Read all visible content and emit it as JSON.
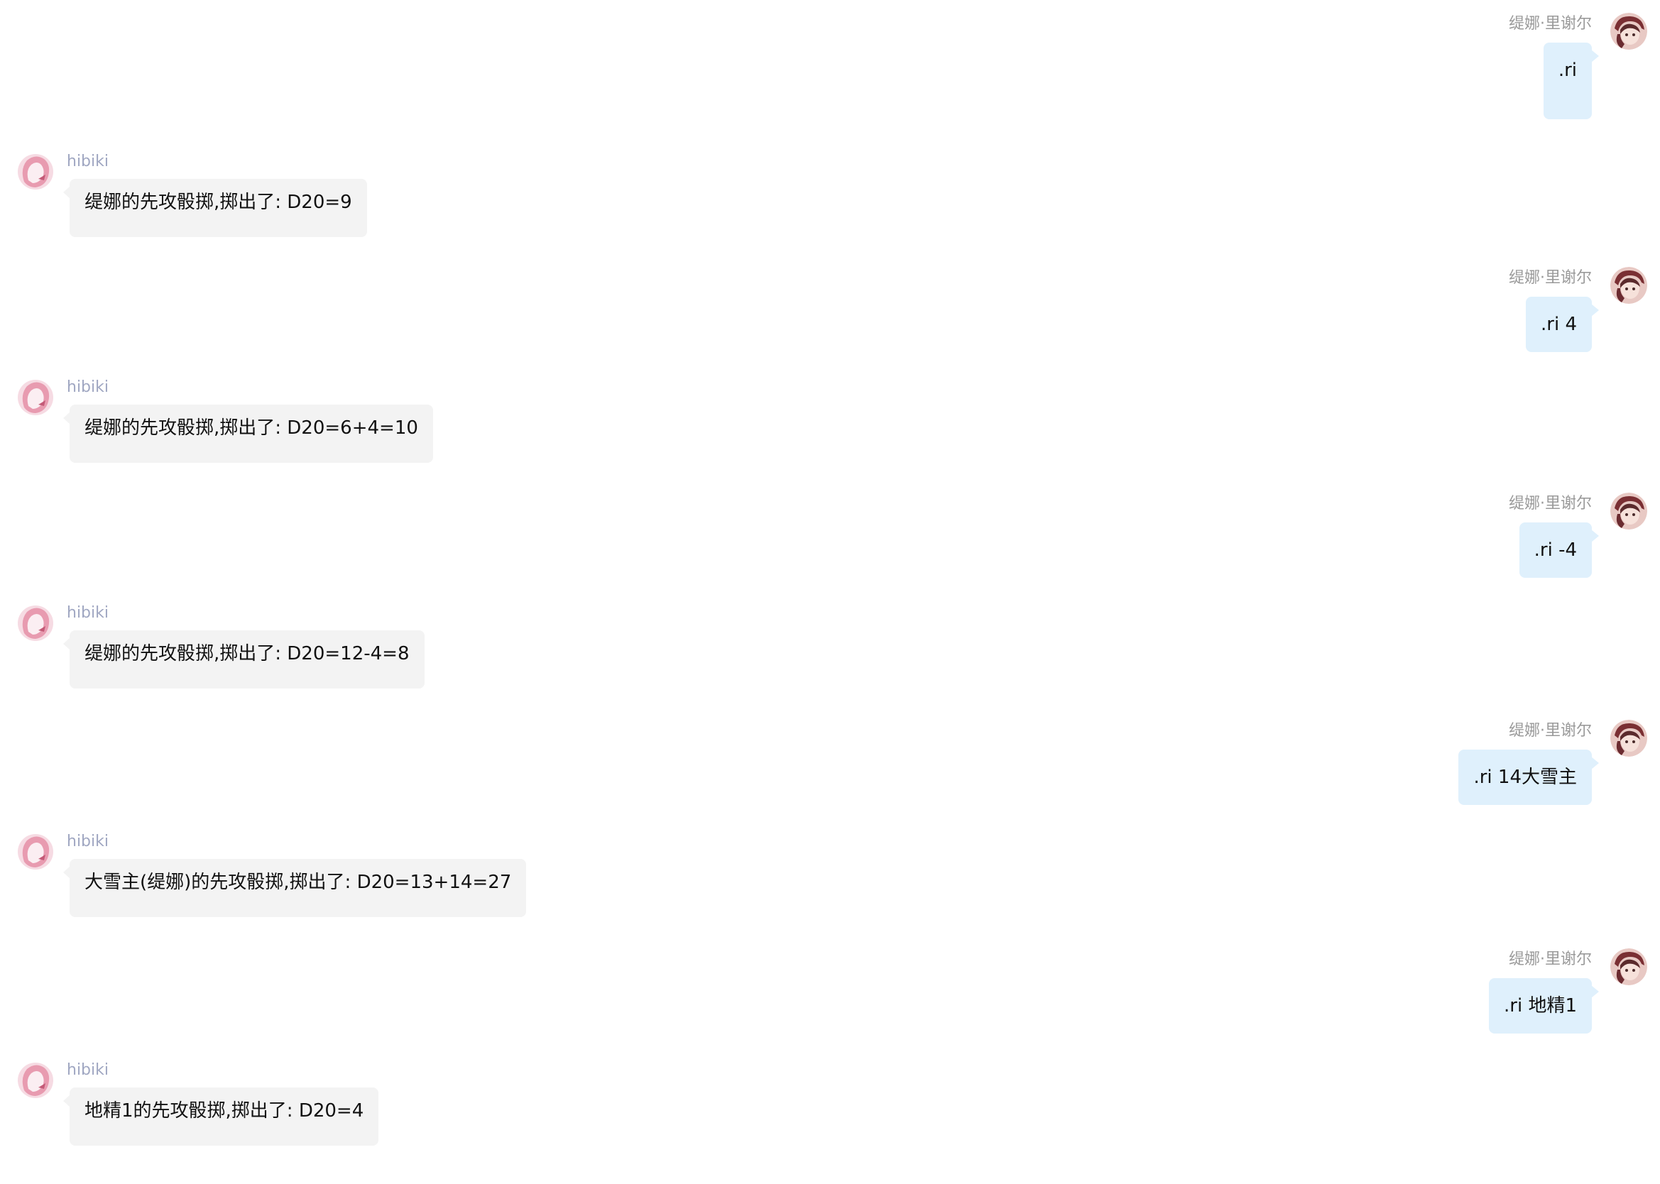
{
  "chat": {
    "messages": [
      {
        "side": "right",
        "sender": "缇娜·里谢尔",
        "text": ".ri"
      },
      {
        "side": "left",
        "sender": "hibiki",
        "text": "缇娜的先攻骰掷,掷出了: D20=9"
      },
      {
        "side": "right",
        "sender": "缇娜·里谢尔",
        "text": ".ri 4"
      },
      {
        "side": "left",
        "sender": "hibiki",
        "text": "缇娜的先攻骰掷,掷出了: D20=6+4=10"
      },
      {
        "side": "right",
        "sender": "缇娜·里谢尔",
        "text": ".ri -4"
      },
      {
        "side": "left",
        "sender": "hibiki",
        "text": "缇娜的先攻骰掷,掷出了: D20=12-4=8"
      },
      {
        "side": "right",
        "sender": "缇娜·里谢尔",
        "text": ".ri 14大雪主"
      },
      {
        "side": "left",
        "sender": "hibiki",
        "text": "大雪主(缇娜)的先攻骰掷,掷出了: D20=13+14=27"
      },
      {
        "side": "right",
        "sender": "缇娜·里谢尔",
        "text": ".ri 地精1"
      },
      {
        "side": "left",
        "sender": "hibiki",
        "text": "地精1的先攻骰掷,掷出了: D20=4"
      }
    ]
  },
  "colors": {
    "user_bubble": "#dff0fc",
    "bot_bubble": "#f3f3f3",
    "bot_name": "#a0a7c2",
    "user_name": "#9a9a9a"
  },
  "icons": {
    "user_avatar": "user-avatar-icon",
    "bot_avatar": "bot-avatar-icon"
  }
}
